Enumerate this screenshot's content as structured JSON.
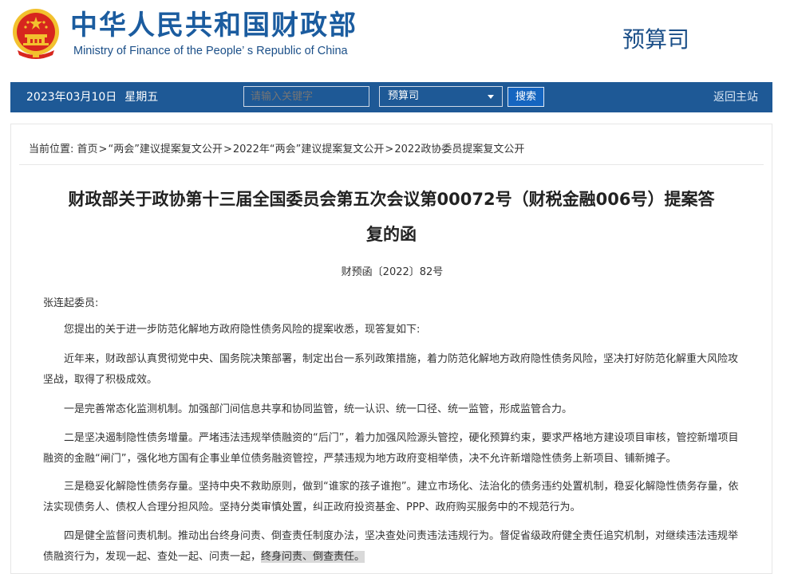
{
  "header": {
    "ministry_cn": "中华人民共和国财政部",
    "ministry_en": "Ministry of Finance of the People’ s Republic of China",
    "department": "预算司"
  },
  "nav": {
    "date": "2023年03月10日",
    "weekday": "星期五",
    "search_placeholder": "请输入关键字",
    "select_value": "预算司",
    "search_button": "搜索",
    "home_link": "返回主站"
  },
  "breadcrumb": {
    "prefix": "当前位置:",
    "items": [
      "首页",
      "“两会”建议提案复文公开",
      "2022年“两会”建议提案复文公开",
      "2022政协委员提案复文公开"
    ],
    "separator": ">"
  },
  "article": {
    "title_line1": "财政部关于政协第十三届全国委员会第五次会议第00072号（财税金融006号）提案答",
    "title_line2": "复的函",
    "doc_number": "财预函〔2022〕82号",
    "addressee": "张连起委员:",
    "paragraphs": [
      "您提出的关于进一步防范化解地方政府隐性债务风险的提案收悉，现答复如下:",
      "近年来，财政部认真贯彻党中央、国务院决策部署，制定出台一系列政策措施，着力防范化解地方政府隐性债务风险，坚决打好防范化解重大风险攻坚战，取得了积极成效。",
      "一是完善常态化监测机制。加强部门间信息共享和协同监管，统一认识、统一口径、统一监管，形成监管合力。",
      "二是坚决遏制隐性债务增量。严堵违法违规举债融资的“后门”，着力加强风险源头管控，硬化预算约束，要求严格地方建设项目审核，管控新增项目融资的金融“闸门”，强化地方国有企事业单位债务融资管控，严禁违规为地方政府变相举债，决不允许新增隐性债务上新项目、铺新摊子。",
      "三是稳妥化解隐性债务存量。坚持中央不救助原则，做到“谁家的孩子谁抱”。建立市场化、法治化的债务违约处置机制，稳妥化解隐性债务存量，依法实现债务人、债权人合理分担风险。坚持分类审慎处置，纠正政府投资基金、PPP、政府购买服务中的不规范行为。"
    ],
    "last_paragraph_main": "四是健全监督问责机制。推动出台终身问责、倒查责任制度办法，坚决查处问责违法违规行为。督促省级政府健全责任追究机制，对继续违法违规举债融资行为，发现一起、查处一起、问责一起，",
    "last_paragraph_highlight": "终身问责、倒查责任。"
  },
  "colors": {
    "nav_bg": "#1e5996",
    "brand_blue": "#1b5c9f",
    "emblem_red": "#d7261e",
    "emblem_gold": "#f2c12e"
  }
}
